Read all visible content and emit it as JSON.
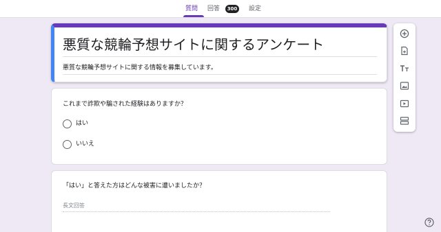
{
  "tabs": {
    "questions": "質問",
    "responses": "回答",
    "response_count": "300",
    "settings": "設定"
  },
  "form": {
    "title": "悪質な競輪予想サイトに関するアンケート",
    "description": "悪質な競輪予想サイトに関する情報を募集しています。"
  },
  "questions": [
    {
      "text": "これまで詐欺や騙された経験はありますか？",
      "options": [
        "はい",
        "いいえ"
      ]
    },
    {
      "text": "「はい」と答えた方はどんな被害に遭いましたか？",
      "answer_placeholder": "長文回答"
    }
  ],
  "toolbar": {
    "icons": [
      "add-question-icon",
      "import-questions-icon",
      "add-title-icon",
      "add-image-icon",
      "add-video-icon",
      "add-section-icon"
    ]
  },
  "colors": {
    "accent": "#673ab7",
    "background": "#efe9f6",
    "focus_border": "#4285f4"
  }
}
